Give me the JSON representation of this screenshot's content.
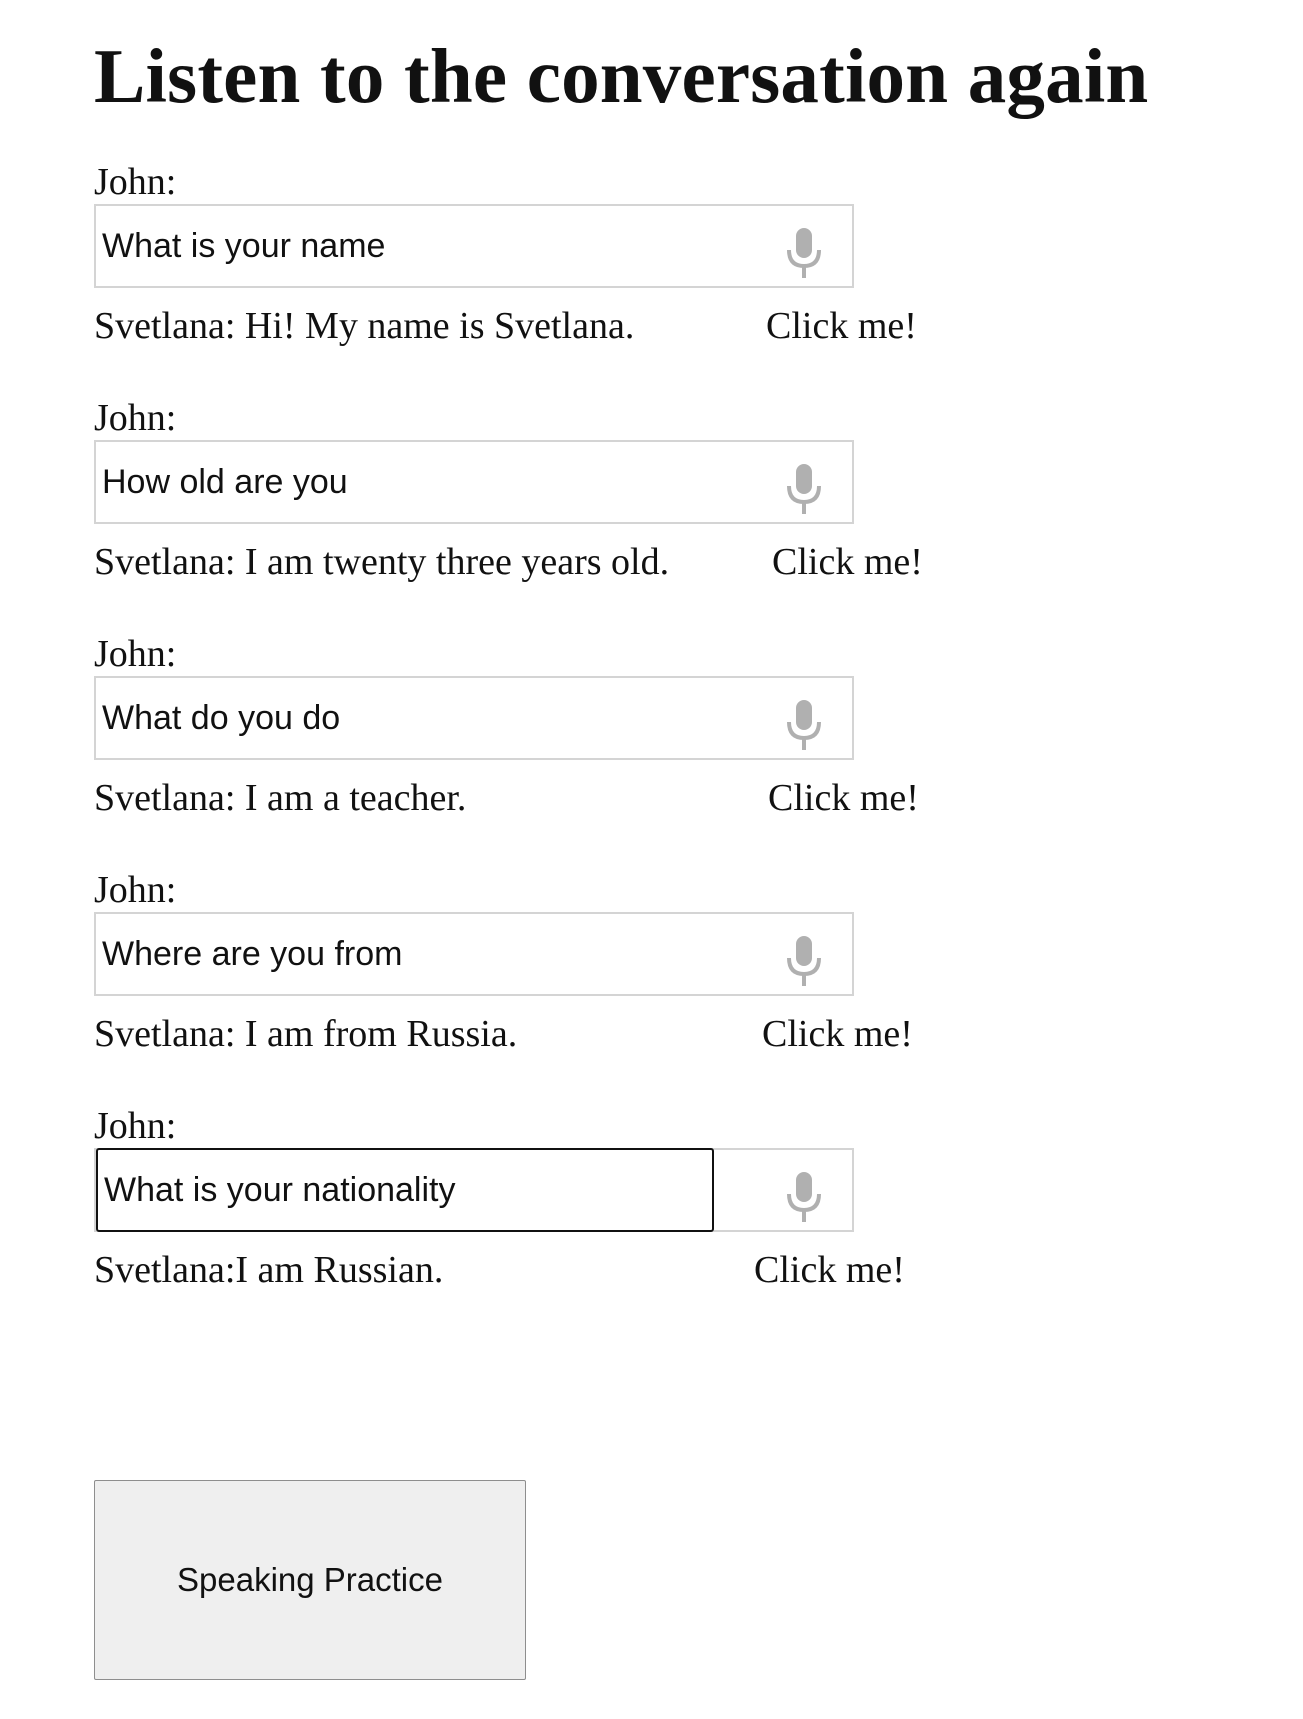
{
  "page": {
    "title": "Listen to the conversation again"
  },
  "conversation": [
    {
      "speaker": "John:",
      "question_value": "What is your name",
      "answer": "Svetlana: Hi! My name is Svetlana.",
      "click_label": "Click me!",
      "focused": false
    },
    {
      "speaker": "John:",
      "question_value": "How old are you",
      "answer": "Svetlana: I am twenty three years old.",
      "click_label": "Click me!",
      "focused": false
    },
    {
      "speaker": "John:",
      "question_value": "What do you do",
      "answer": "Svetlana: I am a teacher.",
      "click_label": "Click me!",
      "focused": false
    },
    {
      "speaker": "John:",
      "question_value": "Where are you from",
      "answer": "Svetlana: I am from Russia.",
      "click_label": "Click me!",
      "focused": false
    },
    {
      "speaker": "John:",
      "question_value": "What is your nationality",
      "answer": "Svetlana:I am Russian.",
      "click_label": "Click me!",
      "focused": true
    }
  ],
  "icons": {
    "mic": "microphone-icon"
  },
  "colors": {
    "mic": "#b0b0b0",
    "input_border": "#d4d4d4",
    "focused_border": "#111111",
    "button_bg": "#efefef"
  },
  "practice_button": {
    "label": "Speaking Practice"
  }
}
